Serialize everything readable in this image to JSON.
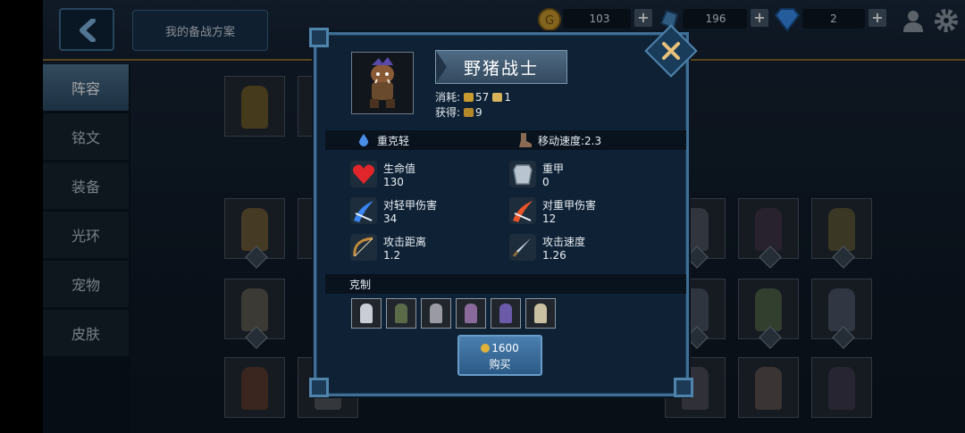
{
  "topbar": {
    "plan_label": "我的备战方案",
    "gold": "103",
    "crystal": "196",
    "diamond": "2"
  },
  "sidebar": {
    "items": [
      {
        "label": "阵容",
        "active": true
      },
      {
        "label": "铭文"
      },
      {
        "label": "装备"
      },
      {
        "label": "光环"
      },
      {
        "label": "宠物"
      },
      {
        "label": "皮肤"
      }
    ]
  },
  "unit": {
    "name": "野猪战士",
    "cost_label": "消耗:",
    "cost_food": "57",
    "cost_pop": "1",
    "gain_label": "获得:",
    "gain_value": "9",
    "type_label": "重克轻",
    "move_speed": "移动速度:2.3"
  },
  "stats": [
    {
      "name": "生命值",
      "value": "130"
    },
    {
      "name": "重甲",
      "value": "0"
    },
    {
      "name": "对轻甲伤害",
      "value": "34"
    },
    {
      "name": "对重甲伤害",
      "value": "12"
    },
    {
      "name": "攻击距离",
      "value": "1.2"
    },
    {
      "name": "攻击速度",
      "value": "1.26"
    }
  ],
  "counter": {
    "title": "克制"
  },
  "buy": {
    "price": "1600",
    "label": "购买"
  },
  "colors": {
    "panel": "#0f2235",
    "border": "#3f6f96",
    "gold": "#c99a2e",
    "buy": "#3c6f9f"
  }
}
